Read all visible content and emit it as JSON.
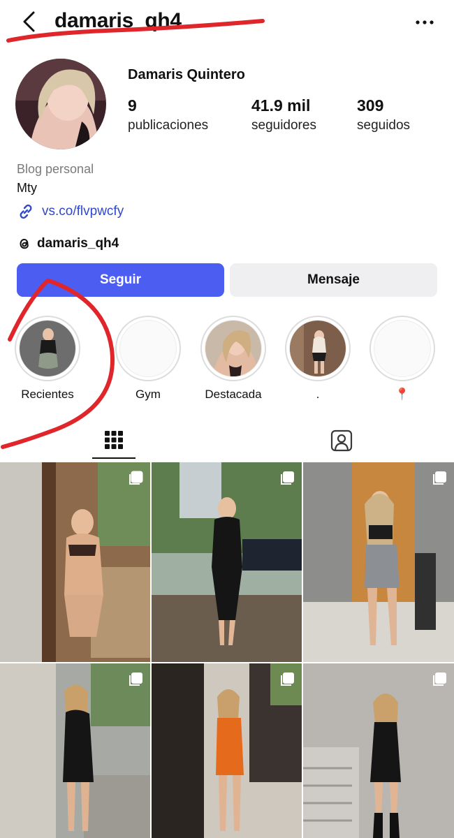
{
  "header": {
    "username": "damaris_qh4",
    "back_icon": "chevron-left-icon",
    "more_icon": "ellipsis-icon"
  },
  "profile": {
    "full_name": "Damaris Quintero",
    "stats": [
      {
        "value": "9",
        "label": "publicaciones"
      },
      {
        "value": "41.9 mil",
        "label": "seguidores"
      },
      {
        "value": "309",
        "label": "seguidos"
      }
    ],
    "category": "Blog personal",
    "bio": "Mty",
    "link": "vs.co/flvpwcfy",
    "threads_handle": "damaris_qh4"
  },
  "actions": {
    "follow_label": "Seguir",
    "message_label": "Mensaje"
  },
  "highlights": [
    {
      "label": "Recientes"
    },
    {
      "label": "Gym"
    },
    {
      "label": "Destacada"
    },
    {
      "label": "."
    },
    {
      "label": "📍"
    }
  ],
  "tabs": [
    {
      "icon": "grid-icon",
      "active": true
    },
    {
      "icon": "tagged-person-icon",
      "active": false
    }
  ],
  "colors": {
    "follow_button": "#4c5ef2",
    "message_button": "#efeff1",
    "link": "#3048c9",
    "annotation": "#e0262a"
  }
}
